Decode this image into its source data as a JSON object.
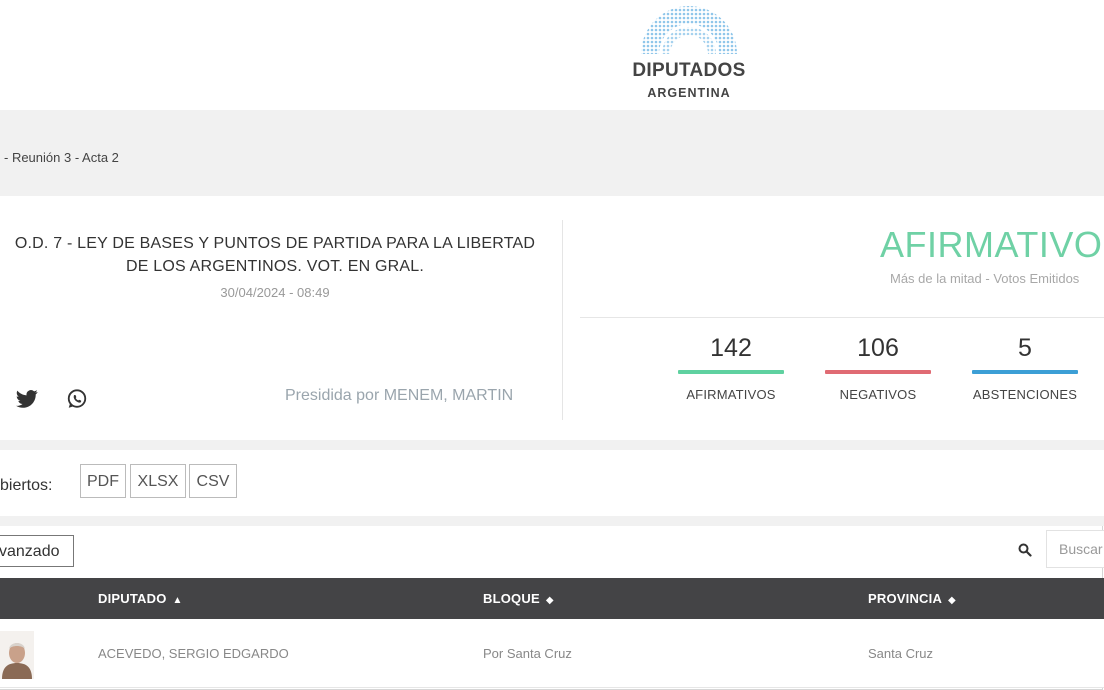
{
  "header": {
    "logo_line1": "DIPUTADOS",
    "logo_line2": "ARGENTINA"
  },
  "breadcrumb": "- Reunión 3 - Acta 2",
  "vote": {
    "title": "O.D. 7 - LEY DE BASES Y PUNTOS DE PARTIDA PARA LA LIBERTAD DE LOS ARGENTINOS. VOT. EN GRAL.",
    "date": "30/04/2024 - 08:49",
    "presided_by": "Presidida por MENEM, MARTIN",
    "result": "AFIRMATIVO",
    "result_rule": "Más de la mitad - Votos Emitidos",
    "result_color": "#6fd1a5",
    "stats": [
      {
        "value": "142",
        "label": "AFIRMATIVOS",
        "color": "#5fd1a0"
      },
      {
        "value": "106",
        "label": "NEGATIVOS",
        "color": "#e06b73"
      },
      {
        "value": "5",
        "label": "ABSTENCIONES",
        "color": "#3c9fd6"
      }
    ],
    "share_icons": [
      "twitter-icon",
      "whatsapp-icon"
    ]
  },
  "downloads": {
    "label": "biertos:",
    "buttons": [
      "PDF",
      "XLSX",
      "CSV"
    ]
  },
  "table_controls": {
    "advanced_button": "vanzado",
    "search_placeholder": "Buscar"
  },
  "table": {
    "columns": [
      {
        "label": "DIPUTADO",
        "sort": "▲"
      },
      {
        "label": "BLOQUE",
        "sort": "◆"
      },
      {
        "label": "PROVINCIA",
        "sort": "◆"
      }
    ],
    "rows": [
      {
        "diputado": "ACEVEDO, SERGIO EDGARDO",
        "bloque": "Por Santa Cruz",
        "provincia": "Santa Cruz"
      }
    ]
  }
}
